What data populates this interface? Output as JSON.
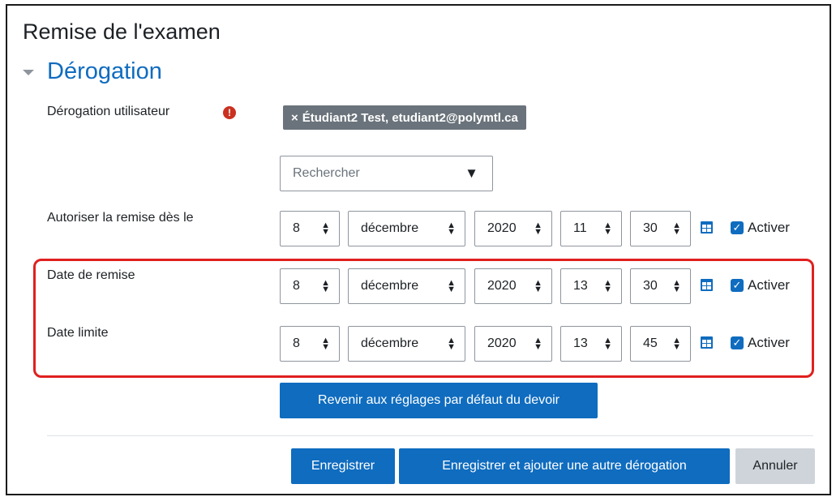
{
  "page": {
    "title": "Remise de l'examen"
  },
  "section": {
    "title": "Dérogation"
  },
  "user_override": {
    "label": "Dérogation utilisateur",
    "required_icon": "!",
    "chip_remove": "×",
    "chip_text": "Étudiant2 Test, etudiant2@polymtl.ca",
    "search_placeholder": "Rechercher",
    "search_arrow": "▼"
  },
  "rows": [
    {
      "label": "Autoriser la remise dès le",
      "day": "8",
      "month": "décembre",
      "year": "2020",
      "hour": "11",
      "minute": "30",
      "enable_label": "Activer",
      "enabled": true
    },
    {
      "label": "Date de remise",
      "day": "8",
      "month": "décembre",
      "year": "2020",
      "hour": "13",
      "minute": "30",
      "enable_label": "Activer",
      "enabled": true
    },
    {
      "label": "Date limite",
      "day": "8",
      "month": "décembre",
      "year": "2020",
      "hour": "13",
      "minute": "45",
      "enable_label": "Activer",
      "enabled": true
    }
  ],
  "select_arrows": "≑",
  "checkmark": "✓",
  "buttons": {
    "reset": "Revenir aux réglages par défaut du devoir",
    "save": "Enregistrer",
    "save_add": "Enregistrer et ajouter une autre dérogation",
    "cancel": "Annuler"
  },
  "colors": {
    "primary": "#0f6cbf",
    "highlight": "#e0201f",
    "chip": "#6a737b",
    "required": "#ca3120"
  },
  "icons": [
    "chevron-down-icon",
    "required-icon",
    "calendar-icon",
    "checkbox-checked-icon",
    "dropdown-arrow-icon"
  ]
}
